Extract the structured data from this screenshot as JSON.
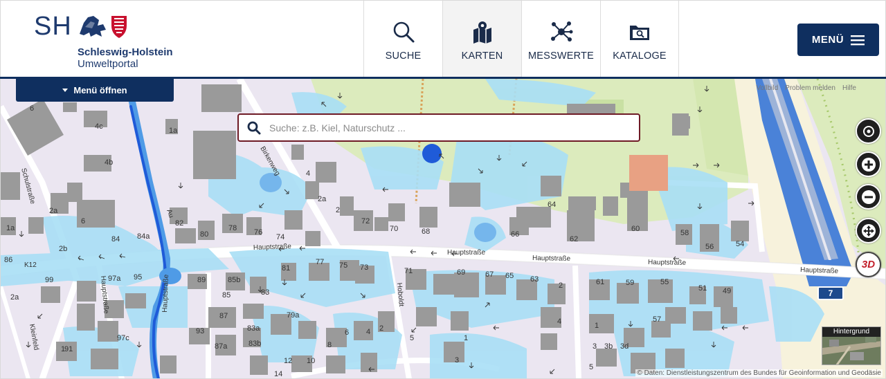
{
  "header": {
    "logo": {
      "short": "SH",
      "name": "Schleswig-Holstein",
      "subtitle": "Umweltportal"
    },
    "nav": [
      {
        "label": "SUCHE",
        "icon": "search-icon"
      },
      {
        "label": "KARTEN",
        "icon": "map-icon"
      },
      {
        "label": "MESSWERTE",
        "icon": "network-icon"
      },
      {
        "label": "KATALOGE",
        "icon": "folder-search-icon"
      }
    ],
    "menu_label": "MENÜ"
  },
  "map": {
    "menu_open_label": "Menü öffnen",
    "search_placeholder": "Suche: z.B. Kiel, Naturschutz ...",
    "top_links": [
      "Vollbild",
      "Problem melden",
      "Hilfe"
    ],
    "background_label": "Hintergrund",
    "attribution": "© Daten: Dienstleistungszentrum des Bundes für Geoinformation und Geodäsie",
    "road_badge": "7",
    "ctrl_3d": "3D",
    "streets": [
      "Hauptstraße",
      "Hauptstraße",
      "Hauptstraße",
      "Hauptstraße",
      "Hauptstraße",
      "K12",
      "Schulstraße",
      "Kleinfeld",
      "Au",
      "Hoboldt",
      "Birkenweg"
    ],
    "house_numbers": [
      "6",
      "4c",
      "1a",
      "4b",
      "4",
      "2a",
      "2",
      "82",
      "80",
      "78",
      "76",
      "74",
      "72",
      "70",
      "68",
      "66",
      "64",
      "62",
      "60",
      "58",
      "56",
      "54",
      "1a",
      "2b",
      "84",
      "84a",
      "86",
      "99",
      "97a",
      "95",
      "89",
      "85b",
      "85",
      "83",
      "81",
      "77",
      "75",
      "73",
      "71",
      "69",
      "67",
      "65",
      "63",
      "61",
      "59",
      "55",
      "51",
      "49",
      "87",
      "79a",
      "93",
      "83a",
      "83b",
      "87a",
      "97c",
      "91",
      "12",
      "10",
      "14",
      "8",
      "6",
      "4",
      "2",
      "1",
      "3",
      "5",
      "4",
      "2",
      "3b",
      "3d",
      "57",
      "1",
      "3",
      "5",
      "2a",
      "6",
      "2a",
      "1"
    ]
  },
  "colors": {
    "brand": "#0f2f5f",
    "search_border": "#6e1a25",
    "flood_light": "#a9dff6",
    "flood_mid": "#4f9be6",
    "flood_dark": "#1f5bd8",
    "building": "#9a9a9a",
    "green": "#dcebbd",
    "highway": "#4a82d8"
  }
}
